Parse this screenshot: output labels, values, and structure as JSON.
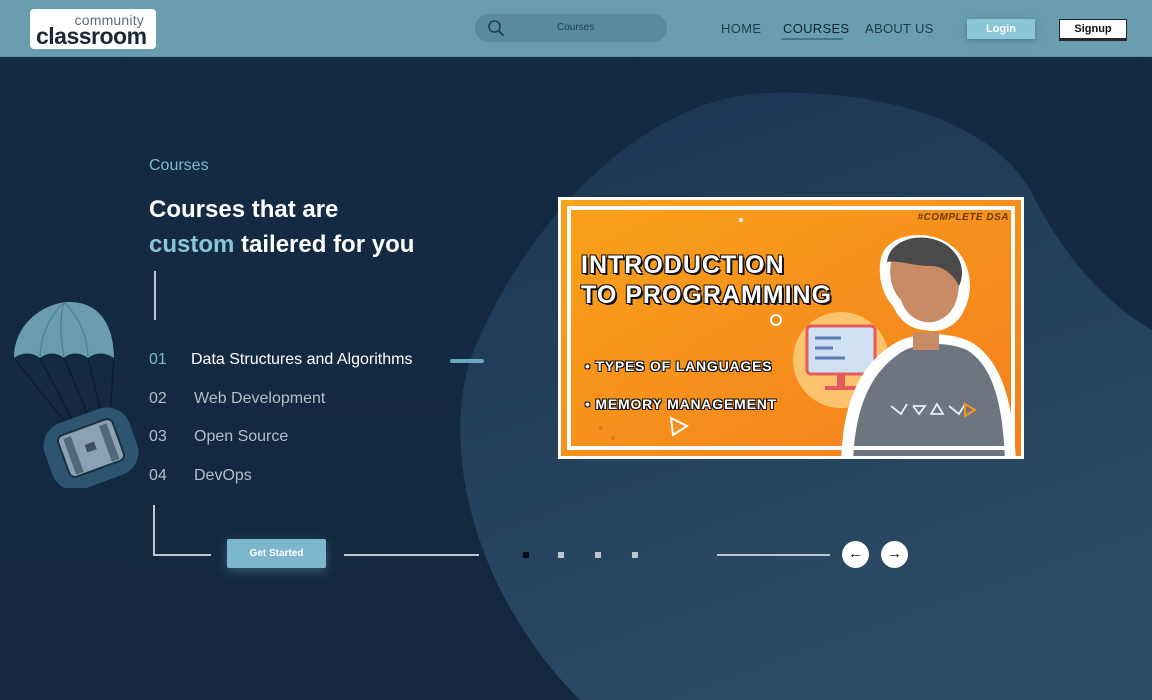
{
  "header": {
    "logo_top": "community",
    "logo_bottom": "classroom",
    "search_placeholder": "Courses",
    "nav": {
      "home": "HOME",
      "courses": "COURSES",
      "about": "ABOUT US"
    },
    "login_label": "Login",
    "signup_label": "Signup"
  },
  "hero": {
    "eyebrow": "Courses",
    "headline_line1": "Courses that are",
    "headline_accent": "custom",
    "headline_rest": " tailered for you",
    "courses": [
      {
        "num": "01",
        "label": "Data Structures and Algorithms",
        "active": true
      },
      {
        "num": "02",
        "label": "Web Development",
        "active": false
      },
      {
        "num": "03",
        "label": "Open Source",
        "active": false
      },
      {
        "num": "04",
        "label": "DevOps",
        "active": false
      }
    ],
    "cta_label": "Get Started",
    "carousel": {
      "slide_count": 4,
      "active_index": 0,
      "prev_icon": "←",
      "next_icon": "→"
    }
  },
  "thumbnail": {
    "tag": "#COMPLETE DSA",
    "title_line1": "INTRODUCTION",
    "title_line2": "TO PROGRAMMING",
    "bullet1": "• TYPES OF LANGUAGES",
    "bullet2": "• MEMORY MANAGEMENT"
  },
  "colors": {
    "header_bg": "#6a9db0",
    "page_bg": "#13283f",
    "accent": "#8ac6d8",
    "thumbnail_bg": "#f7941d"
  }
}
